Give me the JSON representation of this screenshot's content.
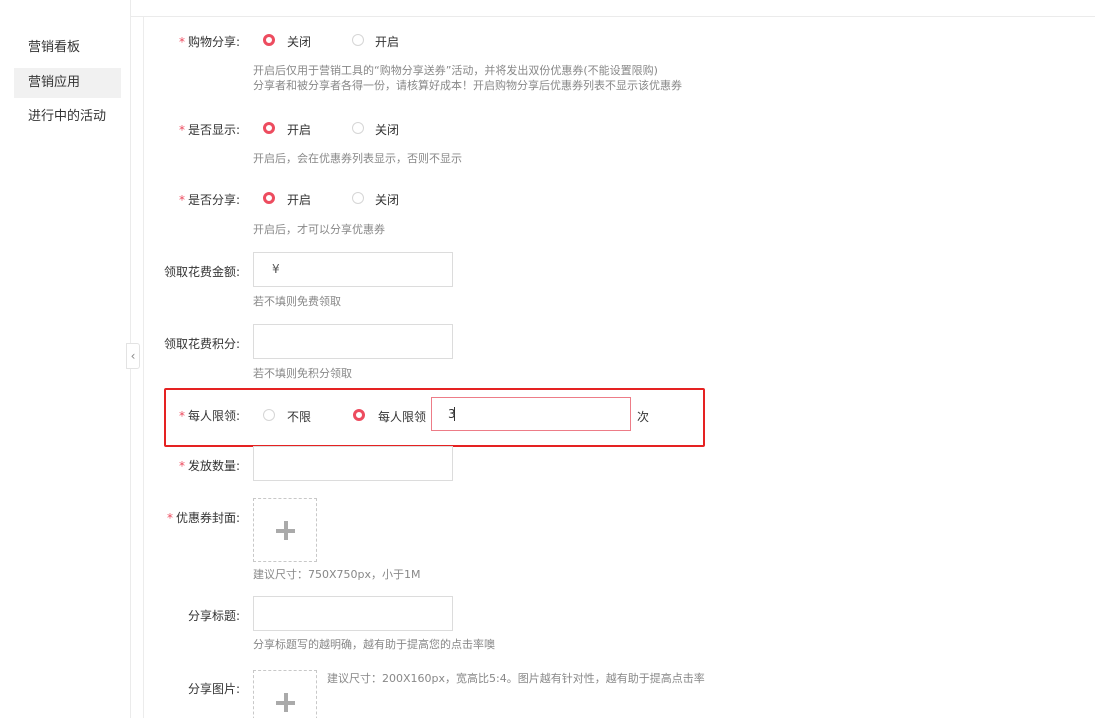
{
  "sidebar": {
    "items": [
      {
        "label": "营销看板"
      },
      {
        "label": "营销应用",
        "active": true
      },
      {
        "label": "进行中的活动"
      }
    ],
    "collapse_icon": "chevron-left-icon"
  },
  "form": {
    "required_mark": "*",
    "shopping_share": {
      "label": "购物分享:",
      "options": [
        "关闭",
        "开启"
      ],
      "selected": "关闭",
      "hint_line1": "开启后仅用于营销工具的“购物分享送券”活动，并将发出双份优惠券(不能设置限购)",
      "hint_line2": "分享者和被分享者各得一份，请核算好成本！开启购物分享后优惠券列表不显示该优惠券"
    },
    "show": {
      "label": "是否显示:",
      "options": [
        "开启",
        "关闭"
      ],
      "selected": "开启",
      "hint": "开启后，会在优惠券列表显示，否则不显示"
    },
    "share": {
      "label": "是否分享:",
      "options": [
        "开启",
        "关闭"
      ],
      "selected": "开启",
      "hint": "开启后，才可以分享优惠券"
    },
    "cost_amount": {
      "label": "领取花费金额:",
      "value": "¥",
      "hint": "若不填则免费领取"
    },
    "cost_points": {
      "label": "领取花费积分:",
      "value": "",
      "hint": "若不填则免积分领取"
    },
    "per_person_limit": {
      "label": "每人限领:",
      "options": [
        "不限",
        "每人限领"
      ],
      "selected": "每人限领",
      "value": "3",
      "unit": "次"
    },
    "issue_quantity": {
      "label": "发放数量:",
      "value": ""
    },
    "coupon_cover": {
      "label": "优惠券封面:",
      "hint": "建议尺寸：750X750px，小于1M"
    },
    "share_title": {
      "label": "分享标题:",
      "value": "",
      "hint": "分享标题写的越明确，越有助于提高您的点击率噢"
    },
    "share_image": {
      "label": "分享图片:",
      "hint": "建议尺寸：200X160px，宽高比5:4。图片越有针对性，越有助于提高点击率"
    }
  },
  "colors": {
    "accent": "#ed4c5f",
    "highlight_border": "#e52222"
  }
}
